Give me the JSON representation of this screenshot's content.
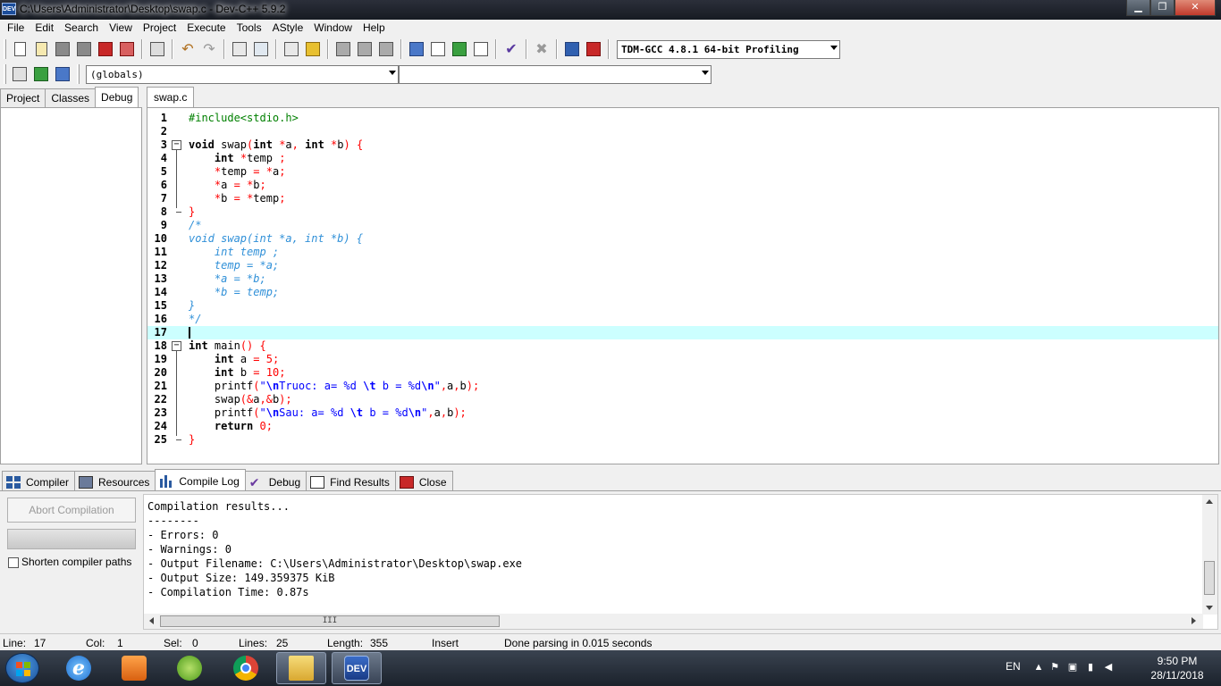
{
  "window": {
    "title": "C:\\Users\\Administrator\\Desktop\\swap.c - Dev-C++ 5.9.2",
    "app_icon_text": "DEV",
    "minimize": "▁",
    "maximize": "❐",
    "close": "✕"
  },
  "menu": [
    "File",
    "Edit",
    "Search",
    "View",
    "Project",
    "Execute",
    "Tools",
    "AStyle",
    "Window",
    "Help"
  ],
  "toolbar": {
    "compiler": "TDM-GCC 4.8.1 64-bit Profiling",
    "scope": "(globals)",
    "member": ""
  },
  "left_tabs": [
    "Project",
    "Classes",
    "Debug"
  ],
  "left_active_tab": "Debug",
  "editor": {
    "file_tab": "swap.c",
    "current_line": 17
  },
  "bottom_tabs": [
    "Compiler",
    "Resources",
    "Compile Log",
    "Debug",
    "Find Results",
    "Close"
  ],
  "bottom_active_tab": "Compile Log",
  "compile_panel": {
    "abort_label": "Abort Compilation",
    "shorten_label": "Shorten compiler paths",
    "shorten_checked": false,
    "log": [
      "Compilation results...",
      "--------",
      "- Errors: 0",
      "- Warnings: 0",
      "- Output Filename: C:\\Users\\Administrator\\Desktop\\swap.exe",
      "- Output Size: 149.359375 KiB",
      "- Compilation Time: 0.87s"
    ],
    "hscroll_grip": "III"
  },
  "status": {
    "line_label": "Line:",
    "line_value": "17",
    "col_label": "Col:",
    "col_value": "1",
    "sel_label": "Sel:",
    "sel_value": "0",
    "lines_label": "Lines:",
    "lines_value": "25",
    "length_label": "Length:",
    "length_value": "355",
    "mode": "Insert",
    "message": "Done parsing in 0.015 seconds"
  },
  "taskbar": {
    "apps": [
      "internet-explorer",
      "media-player",
      "coc-coc",
      "chrome",
      "file-explorer",
      "dev-cpp"
    ],
    "ie_glyph": "e",
    "dev_label": "DEV",
    "language": "EN",
    "time": "9:50 PM",
    "date": "28/11/2018"
  }
}
